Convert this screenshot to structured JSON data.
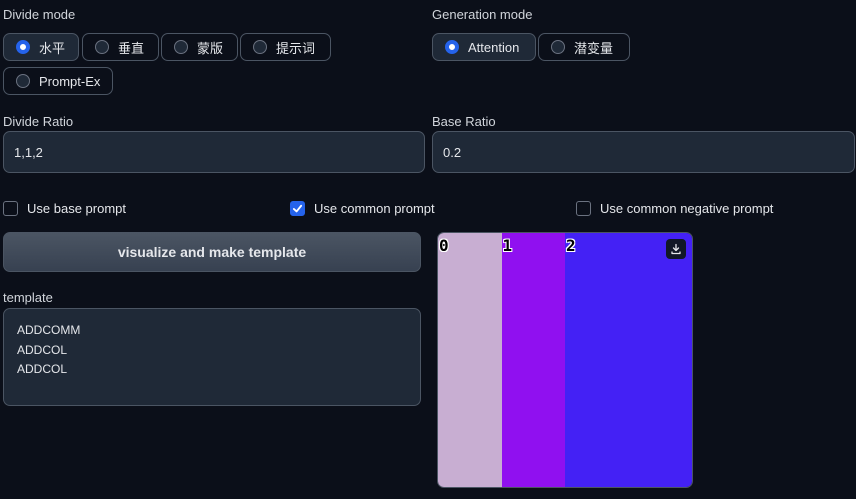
{
  "divide_mode": {
    "label": "Divide mode",
    "options": [
      "水平",
      "垂直",
      "蒙版",
      "提示词",
      "Prompt-Ex"
    ],
    "selected": "水平"
  },
  "generation_mode": {
    "label": "Generation mode",
    "options": [
      "Attention",
      "潜变量"
    ],
    "selected": "Attention"
  },
  "divide_ratio": {
    "label": "Divide Ratio",
    "value": "1,1,2"
  },
  "base_ratio": {
    "label": "Base Ratio",
    "value": "0.2"
  },
  "checkboxes": [
    {
      "label": "Use base prompt",
      "checked": false
    },
    {
      "label": "Use common prompt",
      "checked": true
    },
    {
      "label": "Use common negative prompt",
      "checked": false
    }
  ],
  "visualize_button": "visualize and make template",
  "template": {
    "label": "template",
    "lines": [
      "ADDCOMM",
      "ADDCOL",
      "ADDCOL"
    ]
  },
  "preview": {
    "regions": [
      {
        "label": "0",
        "ratio": 1,
        "color": "#c8aed2"
      },
      {
        "label": "1",
        "ratio": 1,
        "color": "#9010f0"
      },
      {
        "label": "2",
        "ratio": 2,
        "color": "#4421f5"
      }
    ],
    "download_icon": "download-icon"
  },
  "colors": {
    "accent": "#2563eb",
    "background": "#0b0f19",
    "input_bg": "#1f2937"
  }
}
